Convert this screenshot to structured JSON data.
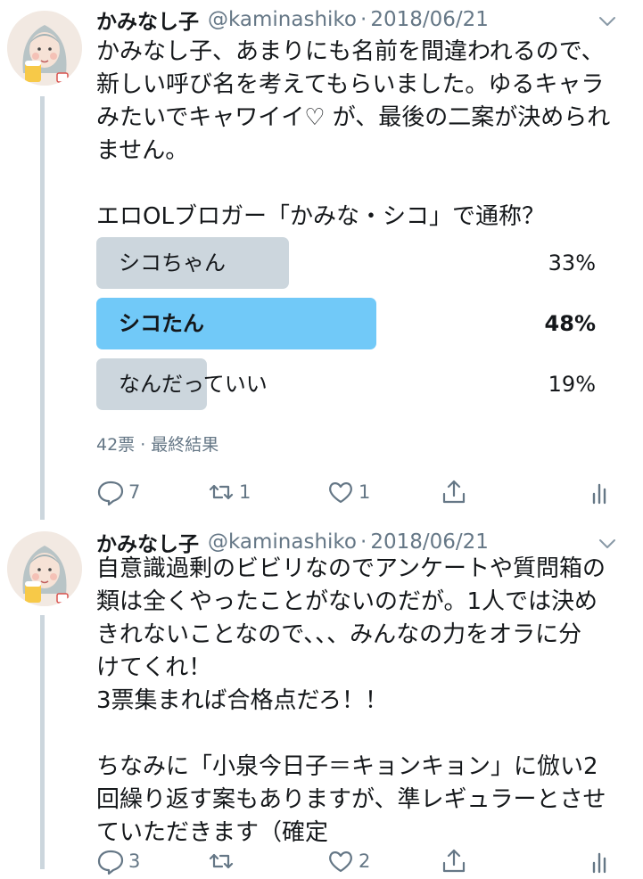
{
  "tweets": [
    {
      "name": "かみなし子",
      "handle": "@kaminashiko",
      "separator": "·",
      "date": "2018/06/21",
      "text": "かみなし子、あまりにも名前を間違われるので、\n新しい呼び名を考えてもらいました。ゆるキャラ\nみたいでキャワイイ♡ が、最後の二案が決められ\nません。\n\nエロOLブロガー「かみな・シコ」で通称？",
      "poll": {
        "options": [
          {
            "label": "シコちゃん",
            "percent": "33%",
            "value": 33,
            "winner": false
          },
          {
            "label": "シコたん",
            "percent": "48%",
            "value": 48,
            "winner": true
          },
          {
            "label": "なんだっていい",
            "percent": "19%",
            "value": 19,
            "winner": false
          }
        ],
        "meta": "42票 · 最終結果",
        "colors": {
          "winner": "#71c9f8",
          "other": "#ccd6dd"
        }
      },
      "actions": {
        "reply": "7",
        "retweet": "1",
        "like": "1"
      }
    },
    {
      "name": "かみなし子",
      "handle": "@kaminashiko",
      "separator": "·",
      "date": "2018/06/21",
      "text": "自意識過剰のビビリなのでアンケートや質問箱の\n類は全くやったことがないのだが。1人では決め\nきれないことなので、、、みんなの力をオラに分\nけてくれ！\n3票集まれば合格点だろ！！\n\nちなみに「小泉今日子＝キョンキョン」に倣い2\n回繰り返す案もありますが、準レギュラーとさせ\nていただきます（確定",
      "actions": {
        "reply": "3",
        "retweet": "",
        "like": "2"
      }
    }
  ],
  "icons": [
    "avatar",
    "chevron-down-icon",
    "reply-icon",
    "retweet-icon",
    "like-icon",
    "share-icon",
    "analytics-icon"
  ],
  "colors": {
    "text": "#14171a",
    "secondary": "#657786",
    "thread": "#ccd6dd",
    "icon": "#657786"
  }
}
